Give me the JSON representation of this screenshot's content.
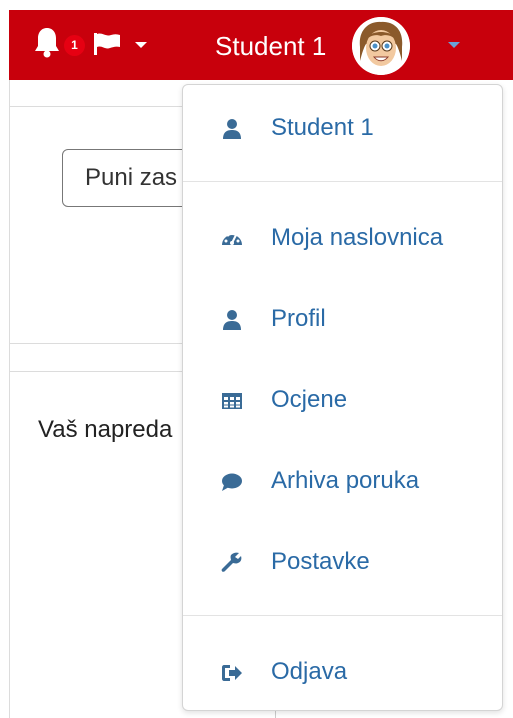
{
  "navbar": {
    "notification_count": "1",
    "username": "Student 1"
  },
  "page": {
    "search_button_label": "Puni zas",
    "progress_label": "Vaš napreda"
  },
  "user_menu": {
    "items": [
      {
        "label": "Student 1",
        "icon": "user-icon"
      },
      {
        "label": "Moja naslovnica",
        "icon": "dashboard-icon"
      },
      {
        "label": "Profil",
        "icon": "user-icon"
      },
      {
        "label": "Ocjene",
        "icon": "table-icon"
      },
      {
        "label": "Arhiva poruka",
        "icon": "comment-icon"
      },
      {
        "label": "Postavke",
        "icon": "wrench-icon"
      },
      {
        "label": "Odjava",
        "icon": "sign-out-icon"
      }
    ]
  },
  "colors": {
    "navbar": "#c8000c",
    "link": "#2a6aa6",
    "icon": "#3a6b96"
  }
}
